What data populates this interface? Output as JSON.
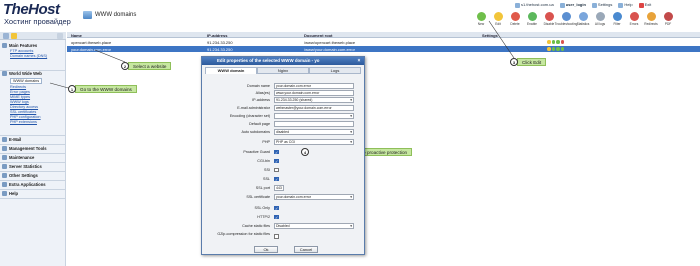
{
  "header": {
    "logo": "TheHost",
    "logo_sub": "Хостинг провайдер",
    "page_title": "WWW domains",
    "topbar": [
      "s1.thehost.com.ua",
      "user_login",
      "Settings",
      "Help",
      "Exit"
    ],
    "toolbar": [
      "New",
      "Edit",
      "Delete",
      "Enable",
      "Disable",
      "Troubleshooting",
      "Statistics",
      "All logs",
      "Filter",
      "Errors",
      "Redirects",
      "PDF"
    ]
  },
  "leftnav": {
    "sections": [
      {
        "label": "Main Features",
        "items": [
          "FTP accounts",
          "Domain names (DNS)"
        ]
      },
      {
        "label": "World Wide Web",
        "items": [
          "WWW domains",
          "Redirects",
          "Error pages",
          "MIME types",
          "WWW logs",
          "Directory access",
          "SSL certificates",
          "PHP configuration",
          "PHP extensions"
        ]
      },
      {
        "label": "E-Mail",
        "items": []
      },
      {
        "label": "Management Tools",
        "items": []
      },
      {
        "label": "Maintenance",
        "items": []
      },
      {
        "label": "Server Statistics",
        "items": []
      },
      {
        "label": "Other Settings",
        "items": []
      },
      {
        "label": "Extra Applications",
        "items": []
      },
      {
        "label": "Help",
        "items": []
      }
    ]
  },
  "table": {
    "headers": [
      "Name",
      "IP-address",
      "Document root",
      "Settings"
    ],
    "rows": [
      {
        "name": "opencart.theweb.place",
        "ip": "91.234.33.250",
        "root": "/www/opencart.theweb.place"
      },
      {
        "name": "your.domain.com.error",
        "ip": "91.234.33.250",
        "root": "/www/your.domain.com.error"
      }
    ]
  },
  "callouts": [
    {
      "num": "1",
      "text": "Go to the WWW domains"
    },
    {
      "num": "2",
      "text": "Select a website"
    },
    {
      "num": "3",
      "text": "Click Edit"
    },
    {
      "num": "4",
      "text": "You can enable or disable proactive protection"
    }
  ],
  "dialog": {
    "title": "Edit properties of the selected WWW domain - yo",
    "close": "×",
    "tabs": [
      "WWW domain",
      "Nginx",
      "Logs"
    ],
    "fields": {
      "domain_name": {
        "label": "Domain name",
        "value": "your.domain.com.error"
      },
      "aliases": {
        "label": "Alias(es)",
        "value": "www.your.domain.com.error"
      },
      "ip": {
        "label": "IP-address",
        "value": "91.234.33.250 (shared)"
      },
      "email": {
        "label": "E-mail administrator",
        "value": "webmaster@your.domain.com.error"
      },
      "encoding": {
        "label": "Encoding (character set)",
        "value": ""
      },
      "default_page": {
        "label": "Default page",
        "value": ""
      },
      "autosub": {
        "label": "Auto subdomains",
        "value": "disabled"
      },
      "php": {
        "label": "PHP",
        "value": "PHP as CGI"
      },
      "proactive": {
        "label": "Proactive Guard",
        "checked": true
      },
      "cgi": {
        "label": "CGI-bin",
        "checked": true
      },
      "ssi": {
        "label": "SSI",
        "checked": false
      },
      "ssl": {
        "label": "SSL",
        "checked": true
      },
      "ssl_port": {
        "label": "SSL port",
        "value": "443"
      },
      "ssl_cert": {
        "label": "SSL certificate",
        "value": "your.domain.com.error"
      },
      "ssl_only": {
        "label": "SSL Only",
        "checked": true
      },
      "http2": {
        "label": "HTTP/2",
        "checked": true
      },
      "cache": {
        "label": "Cache static files",
        "value": "Disabled"
      },
      "gzip": {
        "label": "GZip-compression for static files",
        "checked": false
      }
    },
    "ok": "Ok",
    "cancel": "Cancel"
  },
  "colors": {
    "accent": "#3d75c4",
    "callout": "#c6e7a0",
    "sidebar": "#eef2f8"
  }
}
